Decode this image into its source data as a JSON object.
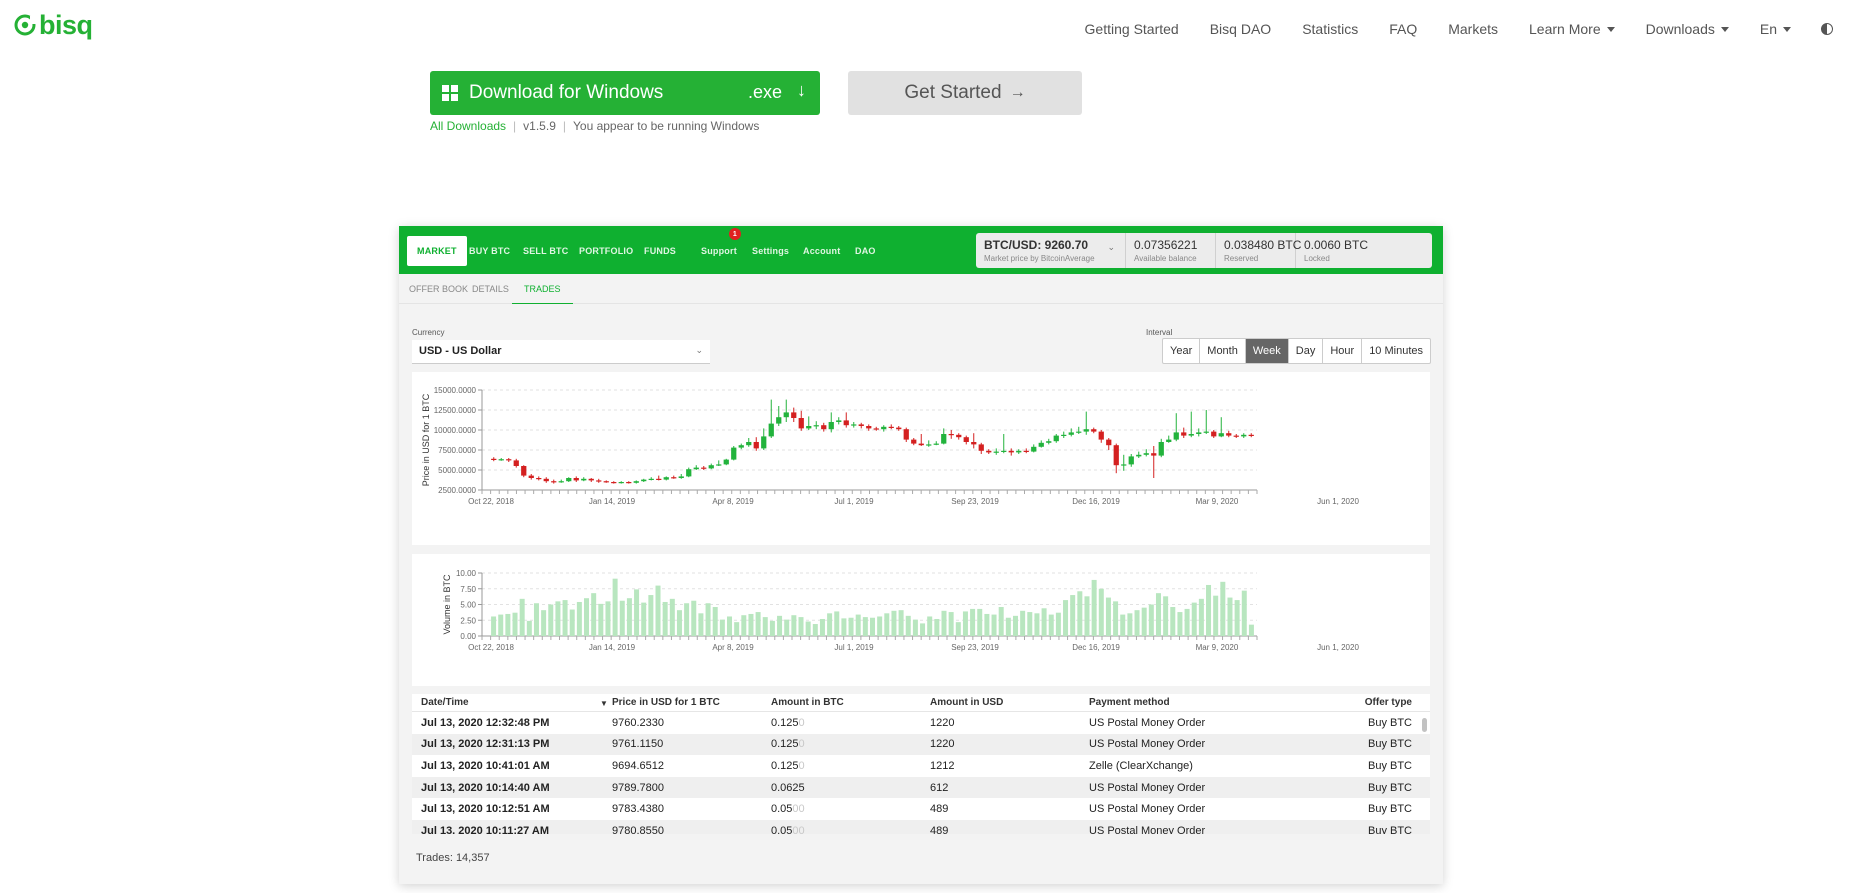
{
  "brand": {
    "name": "bisq",
    "color": "#25b135"
  },
  "nav": {
    "items": [
      {
        "label": "Getting Started",
        "dropdown": false
      },
      {
        "label": "Bisq DAO",
        "dropdown": false
      },
      {
        "label": "Statistics",
        "dropdown": false
      },
      {
        "label": "FAQ",
        "dropdown": false
      },
      {
        "label": "Markets",
        "dropdown": false
      },
      {
        "label": "Learn More",
        "dropdown": true
      },
      {
        "label": "Downloads",
        "dropdown": true
      },
      {
        "label": "En",
        "dropdown": true
      }
    ],
    "theme_icon": "half-circle-icon"
  },
  "download": {
    "button_label": "Download for Windows",
    "extension": ".exe",
    "get_started_label": "Get Started",
    "all_downloads": "All Downloads",
    "version": "v1.5.9",
    "os_note": "You appear to be running Windows"
  },
  "app": {
    "tabs": [
      {
        "label": "MARKET",
        "active": true
      },
      {
        "label": "BUY BTC"
      },
      {
        "label": "SELL BTC"
      },
      {
        "label": "PORTFOLIO"
      },
      {
        "label": "FUNDS"
      },
      {
        "label": "Support",
        "badge": "1"
      },
      {
        "label": "Settings"
      },
      {
        "label": "Account"
      },
      {
        "label": "DAO"
      }
    ],
    "balances": [
      {
        "value": "BTC/USD: 9260.70",
        "label": "Market price by BitcoinAverage"
      },
      {
        "value": "0.07356221",
        "label": "Available balance"
      },
      {
        "value": "0.038480 BTC",
        "label": "Reserved"
      },
      {
        "value": "0.0060 BTC",
        "label": "Locked"
      }
    ],
    "sub_tabs": [
      {
        "label": "OFFER BOOK"
      },
      {
        "label": "DETAILS"
      },
      {
        "label": "TRADES",
        "active": true
      }
    ],
    "currency_label": "Currency",
    "currency_value": "USD  -  US Dollar",
    "interval_label": "Interval",
    "intervals": [
      {
        "label": "Year"
      },
      {
        "label": "Month"
      },
      {
        "label": "Week",
        "active": true
      },
      {
        "label": "Day"
      },
      {
        "label": "Hour"
      },
      {
        "label": "10 Minutes"
      }
    ],
    "table": {
      "headers": [
        "Date/Time",
        "Price in USD for 1 BTC",
        "Amount in BTC",
        "Amount in USD",
        "Payment method",
        "Offer type"
      ],
      "rows": [
        {
          "date": "Jul 13, 2020 12:32:48 PM",
          "price": "9760.2330",
          "amt": "0.125",
          "amt_dim": "0",
          "usd": "1220",
          "method": "US Postal Money Order",
          "type": "Buy BTC"
        },
        {
          "date": "Jul 13, 2020 12:31:13 PM",
          "price": "9761.1150",
          "amt": "0.125",
          "amt_dim": "0",
          "usd": "1220",
          "method": "US Postal Money Order",
          "type": "Buy BTC"
        },
        {
          "date": "Jul 13, 2020 10:41:01 AM",
          "price": "9694.6512",
          "amt": "0.125",
          "amt_dim": "0",
          "usd": "1212",
          "method": "Zelle (ClearXchange)",
          "type": "Buy BTC"
        },
        {
          "date": "Jul 13, 2020 10:14:40 AM",
          "price": "9789.7800",
          "amt": "0.0625",
          "amt_dim": "",
          "usd": "612",
          "method": "US Postal Money Order",
          "type": "Buy BTC"
        },
        {
          "date": "Jul 13, 2020 10:12:51 AM",
          "price": "9783.4380",
          "amt": "0.05",
          "amt_dim": "00",
          "usd": "489",
          "method": "US Postal Money Order",
          "type": "Buy BTC"
        },
        {
          "date": "Jul 13, 2020 10:11:27 AM",
          "price": "9780.8550",
          "amt": "0.05",
          "amt_dim": "00",
          "usd": "489",
          "method": "US Postal Money Order",
          "type": "Buy BTC"
        }
      ]
    },
    "trades_count": "Trades: 14,357"
  },
  "chart_data": [
    {
      "type": "candlestick",
      "ylabel": "Price in USD for 1 BTC",
      "ylim": [
        2500,
        15000
      ],
      "yticks": [
        "15000.0000",
        "12500.0000",
        "10000.0000",
        "7500.0000",
        "5000.0000",
        "2500.0000"
      ],
      "xticks": [
        "Oct 22, 2018",
        "Jan 14, 2019",
        "Apr 8, 2019",
        "Jul 1, 2019",
        "Sep 23, 2019",
        "Dec 16, 2019",
        "Mar 9, 2020",
        "Jun 1, 2020"
      ],
      "grid": true,
      "colors": {
        "up": "#22b33c",
        "down": "#d42020"
      },
      "candles": [
        [
          6400,
          6300,
          6600,
          6100
        ],
        [
          6300,
          6350,
          6500,
          6150
        ],
        [
          6350,
          6200,
          6500,
          6000
        ],
        [
          6200,
          5500,
          6400,
          5300
        ],
        [
          5500,
          4300,
          5600,
          4100
        ],
        [
          4300,
          4000,
          4500,
          3800
        ],
        [
          4000,
          3900,
          4200,
          3700
        ],
        [
          3900,
          3600,
          4100,
          3400
        ],
        [
          3600,
          3500,
          3800,
          3300
        ],
        [
          3500,
          3600,
          3800,
          3400
        ],
        [
          3600,
          4000,
          4100,
          3500
        ],
        [
          4000,
          3700,
          4200,
          3500
        ],
        [
          3700,
          3900,
          4100,
          3600
        ],
        [
          3900,
          3700,
          4000,
          3500
        ],
        [
          3700,
          3600,
          3900,
          3400
        ],
        [
          3600,
          3500,
          3700,
          3400
        ],
        [
          3500,
          3400,
          3600,
          3300
        ],
        [
          3400,
          3500,
          3600,
          3300
        ],
        [
          3500,
          3400,
          3600,
          3300
        ],
        [
          3400,
          3600,
          3700,
          3300
        ],
        [
          3600,
          3800,
          3900,
          3500
        ],
        [
          3800,
          3900,
          4100,
          3700
        ],
        [
          3900,
          3800,
          4300,
          3700
        ],
        [
          3800,
          4100,
          4200,
          3700
        ],
        [
          4100,
          4000,
          4300,
          3900
        ],
        [
          4000,
          4200,
          4500,
          3900
        ],
        [
          4200,
          5100,
          5300,
          4100
        ],
        [
          5100,
          5300,
          5600,
          5000
        ],
        [
          5300,
          5200,
          5500,
          5000
        ],
        [
          5200,
          5600,
          5800,
          5100
        ],
        [
          5600,
          5700,
          6200,
          5500
        ],
        [
          5700,
          6300,
          6400,
          5600
        ],
        [
          6300,
          7800,
          8000,
          6200
        ],
        [
          7800,
          8100,
          8300,
          7600
        ],
        [
          8100,
          8500,
          9000,
          7900
        ],
        [
          8500,
          7700,
          9100,
          7400
        ],
        [
          7700,
          9200,
          10200,
          7500
        ],
        [
          9200,
          10800,
          13800,
          9000
        ],
        [
          10800,
          11600,
          13000,
          10500
        ],
        [
          11600,
          12200,
          13800,
          11000
        ],
        [
          12200,
          11500,
          12800,
          11000
        ],
        [
          11500,
          10200,
          12400,
          9900
        ],
        [
          10200,
          10500,
          11700,
          10000
        ],
        [
          10500,
          10600,
          11100,
          10100
        ],
        [
          10600,
          10100,
          10900,
          9800
        ],
        [
          10100,
          11000,
          12200,
          9700
        ],
        [
          11000,
          11200,
          11600,
          10700
        ],
        [
          11200,
          10600,
          12200,
          10300
        ],
        [
          10600,
          10700,
          11000,
          10300
        ],
        [
          10700,
          10500,
          10900,
          10200
        ],
        [
          10500,
          10200,
          10700,
          9900
        ],
        [
          10200,
          10100,
          10400,
          9900
        ],
        [
          10100,
          10400,
          10600,
          9800
        ],
        [
          10400,
          10300,
          10700,
          10100
        ],
        [
          10300,
          10100,
          10500,
          9900
        ],
        [
          10100,
          8800,
          10300,
          8500
        ],
        [
          8800,
          8300,
          9000,
          8100
        ],
        [
          8300,
          8100,
          9500,
          8000
        ],
        [
          8100,
          8200,
          8700,
          7900
        ],
        [
          8200,
          8300,
          8600,
          8100
        ],
        [
          8300,
          9500,
          10200,
          8200
        ],
        [
          9500,
          9400,
          10000,
          8900
        ],
        [
          9400,
          9100,
          9600,
          8800
        ],
        [
          9100,
          8500,
          9300,
          8200
        ],
        [
          8500,
          8200,
          9600,
          7700
        ],
        [
          8200,
          7400,
          8400,
          7000
        ],
        [
          7400,
          7200,
          7600,
          7000
        ],
        [
          7200,
          7300,
          7700,
          6900
        ],
        [
          7300,
          7400,
          9500,
          7100
        ],
        [
          7400,
          7200,
          7700,
          6800
        ],
        [
          7200,
          7400,
          7600,
          7000
        ],
        [
          7400,
          7300,
          7700,
          7100
        ],
        [
          7300,
          7900,
          8200,
          7200
        ],
        [
          7900,
          8400,
          8700,
          7800
        ],
        [
          8400,
          8600,
          8900,
          8200
        ],
        [
          8600,
          9300,
          9500,
          8400
        ],
        [
          9300,
          9400,
          9800,
          9000
        ],
        [
          9400,
          9700,
          10200,
          9200
        ],
        [
          9700,
          9800,
          10400,
          9500
        ],
        [
          9800,
          10100,
          12300,
          9400
        ],
        [
          10100,
          9800,
          10300,
          9600
        ],
        [
          9800,
          8800,
          10000,
          8400
        ],
        [
          8800,
          8100,
          9000,
          7500
        ],
        [
          8100,
          5600,
          8300,
          4600
        ],
        [
          5600,
          5700,
          6900,
          4900
        ],
        [
          5700,
          6700,
          7000,
          5400
        ],
        [
          6700,
          6900,
          7300,
          6500
        ],
        [
          6900,
          7100,
          7600,
          6700
        ],
        [
          7100,
          6800,
          8000,
          4000
        ],
        [
          6800,
          8500,
          8900,
          6600
        ],
        [
          8500,
          8800,
          9300,
          8400
        ],
        [
          8800,
          9700,
          12100,
          8600
        ],
        [
          9700,
          9300,
          10300,
          9000
        ],
        [
          9300,
          9500,
          12300,
          9100
        ],
        [
          9500,
          9700,
          10200,
          9200
        ],
        [
          9700,
          9800,
          12500,
          9500
        ],
        [
          9800,
          9200,
          10000,
          9000
        ],
        [
          9200,
          9600,
          11600,
          9100
        ],
        [
          9600,
          9300,
          9900,
          9100
        ],
        [
          9300,
          9200,
          9500,
          9000
        ],
        [
          9200,
          9400,
          9600,
          9000
        ],
        [
          9400,
          9300,
          9600,
          9100
        ]
      ]
    },
    {
      "type": "bar",
      "ylabel": "Volume in BTC",
      "ylim": [
        0,
        10
      ],
      "yticks": [
        "10.00",
        "7.50",
        "5.00",
        "2.50",
        "0.00"
      ],
      "xticks": [
        "Oct 22, 2018",
        "Jan 14, 2019",
        "Apr 8, 2019",
        "Jul 1, 2019",
        "Sep 23, 2019",
        "Dec 16, 2019",
        "Mar 9, 2020",
        "Jun 1, 2020"
      ],
      "grid": true,
      "color": "#b8e6bf",
      "values": [
        3.1,
        3.4,
        3.5,
        3.7,
        5.9,
        2.4,
        5.2,
        4.1,
        5.0,
        5.5,
        5.7,
        4.2,
        5.4,
        6.0,
        6.8,
        5.1,
        5.5,
        9.1,
        5.6,
        6.0,
        7.4,
        5.3,
        6.5,
        8.0,
        5.4,
        5.9,
        4.1,
        5.2,
        5.6,
        3.6,
        5.2,
        4.6,
        2.6,
        3.1,
        2.2,
        3.3,
        3.5,
        3.8,
        3.0,
        2.4,
        3.2,
        2.6,
        3.3,
        3.0,
        2.3,
        1.9,
        2.7,
        3.6,
        3.9,
        2.8,
        2.9,
        3.4,
        3.0,
        2.9,
        3.1,
        3.6,
        4.0,
        4.1,
        3.2,
        2.6,
        2.0,
        3.1,
        2.7,
        4.0,
        3.8,
        2.2,
        3.9,
        4.3,
        4.3,
        3.5,
        3.4,
        4.6,
        2.9,
        3.2,
        4.0,
        3.8,
        3.6,
        4.4,
        3.4,
        3.7,
        5.7,
        6.5,
        7.1,
        6.3,
        8.9,
        7.5,
        6.1,
        5.5,
        3.4,
        3.6,
        4.1,
        4.5,
        5.0,
        6.8,
        6.3,
        4.6,
        3.8,
        4.3,
        5.3,
        5.9,
        8.1,
        6.4,
        8.6,
        6.1,
        5.7,
        7.2,
        1.8
      ]
    }
  ]
}
